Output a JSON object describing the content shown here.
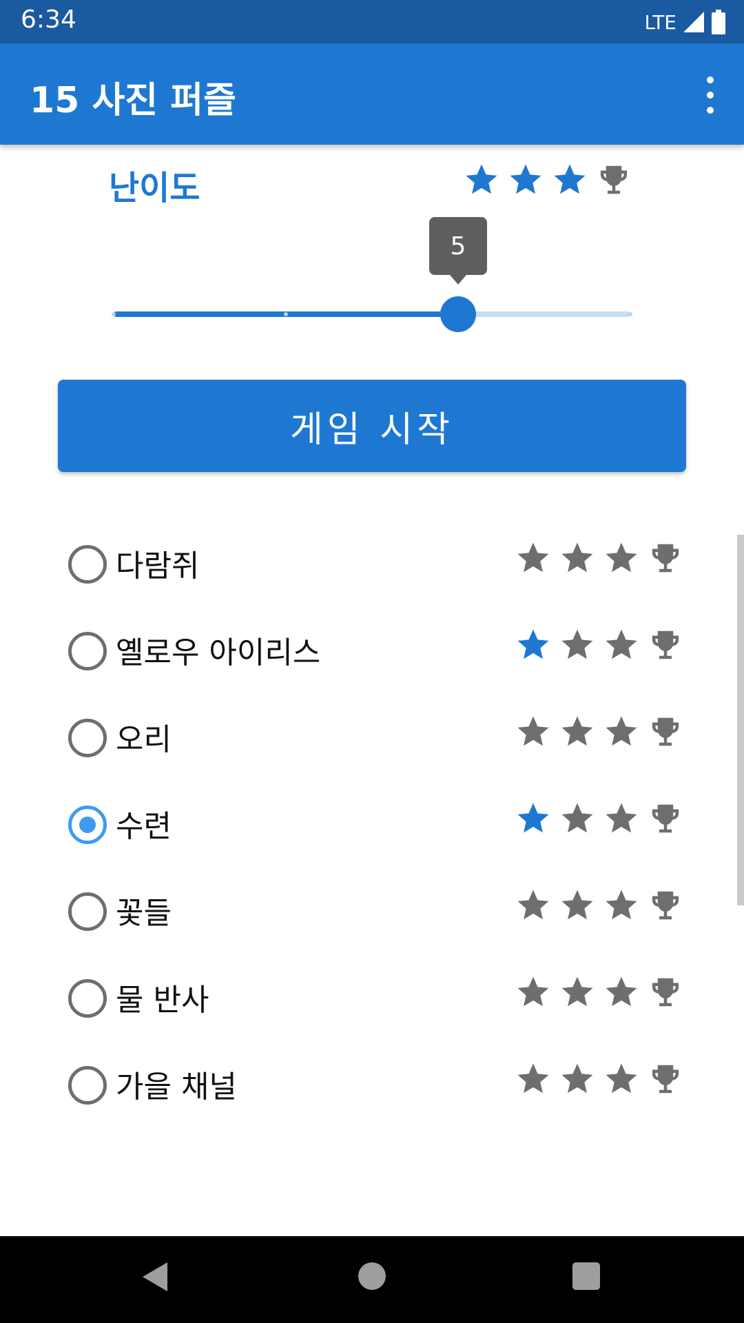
{
  "status_bar": {
    "time": "6:34",
    "network": "LTE"
  },
  "app_bar": {
    "title": "15 사진 퍼즐"
  },
  "difficulty": {
    "label": "난이도",
    "stars_filled": 3,
    "stars_total": 3,
    "trophy": false
  },
  "slider": {
    "value": "5",
    "fraction": 0.667,
    "tick_count": 4
  },
  "start_button": {
    "label": "게임 시작"
  },
  "puzzles": [
    {
      "name": "다람쥐",
      "selected": false,
      "stars": 0
    },
    {
      "name": "옐로우 아이리스",
      "selected": false,
      "stars": 1
    },
    {
      "name": "오리",
      "selected": false,
      "stars": 0
    },
    {
      "name": "수련",
      "selected": true,
      "stars": 1
    },
    {
      "name": "꽃들",
      "selected": false,
      "stars": 0
    },
    {
      "name": "물 반사",
      "selected": false,
      "stars": 0
    },
    {
      "name": "가을 채널",
      "selected": false,
      "stars": 0
    }
  ],
  "colors": {
    "primary": "#1e78d2",
    "status_bar": "#1a5aa0",
    "inactive_icon": "#6e6e6e",
    "radio_checked": "#3d9bf0"
  },
  "icons": {
    "rating_star": "star-icon",
    "rating_trophy": "trophy-icon"
  }
}
